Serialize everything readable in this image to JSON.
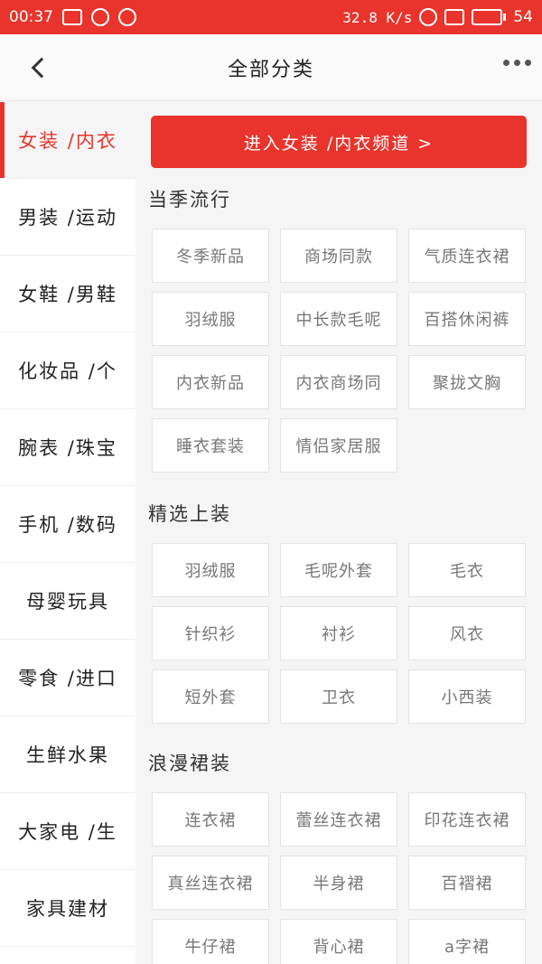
{
  "status_bar": {
    "time": "00:37",
    "speed": "32.8 K/s",
    "battery": "54",
    "battery_level_pct": 54
  },
  "header": {
    "title": "全部分类"
  },
  "sidebar": {
    "items": [
      "女装 /内衣",
      "男装 /运动",
      "女鞋 /男鞋",
      "化妆品 /个",
      "腕表 /珠宝",
      "手机 /数码",
      "母婴玩具",
      "零食 /进口",
      "生鲜水果",
      "大家电 /生",
      "家具建材"
    ],
    "active_index": 0
  },
  "content": {
    "enter_button": "进入女装 /内衣频道 >",
    "sections": [
      {
        "title": "当季流行",
        "tags": [
          "冬季新品",
          "商场同款",
          "气质连衣裙",
          "羽绒服",
          "中长款毛呢",
          "百搭休闲裤",
          "内衣新品",
          "内衣商场同",
          "聚拢文胸",
          "睡衣套装",
          "情侣家居服"
        ]
      },
      {
        "title": "精选上装",
        "tags": [
          "羽绒服",
          "毛呢外套",
          "毛衣",
          "针织衫",
          "衬衫",
          "风衣",
          "短外套",
          "卫衣",
          "小西装"
        ]
      },
      {
        "title": "浪漫裙装",
        "tags": [
          "连衣裙",
          "蕾丝连衣裙",
          "印花连衣裙",
          "真丝连衣裙",
          "半身裙",
          "百褶裙",
          "牛仔裙",
          "背心裙",
          "a字裙"
        ]
      }
    ]
  },
  "colors": {
    "accent": "#e8342c"
  }
}
